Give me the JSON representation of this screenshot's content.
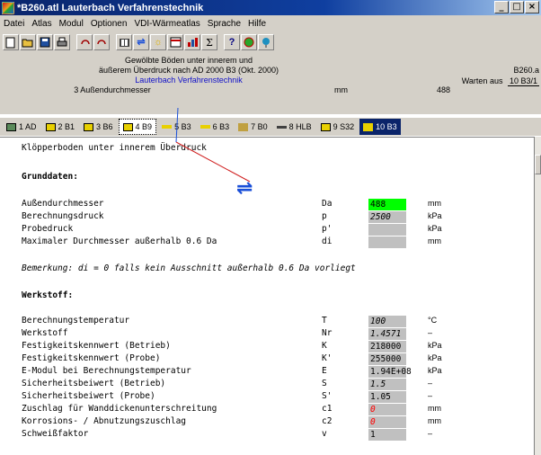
{
  "window": {
    "title": "*B260.atl   Lauterbach Verfahrenstechnik",
    "min": "_",
    "max": "□",
    "close": "×"
  },
  "menu": [
    "Datei",
    "Atlas",
    "Modul",
    "Optionen",
    "VDI-Wärmeatlas",
    "Sprache",
    "Hilfe"
  ],
  "toolbar_icons": [
    "new-icon",
    "open-icon",
    "save-icon",
    "print-icon",
    "undo-icon",
    "redo-icon",
    "book-icon",
    "swap-icon",
    "lightbulb-icon",
    "table-icon",
    "chart-icon",
    "sum-icon",
    "help-icon",
    "globe-icon",
    "info-icon"
  ],
  "header": {
    "line1": "Gewölbte Böden unter innerem und",
    "line2": "äußerem Überdruck nach AD 2000 B3 (Okt. 2000)",
    "line3": "Lauterbach Verfahrenstechnik",
    "line4_label": "3 Außendurchmesser",
    "line4_unit": "mm",
    "line4_value": "488",
    "right_top": "B260.a",
    "warten_label": "Warten aus",
    "warten_value": "10 B3/1"
  },
  "tabs": [
    {
      "label": "1 AD",
      "color": "#5a8a5a"
    },
    {
      "label": "2 B1",
      "color": "#e8d000"
    },
    {
      "label": "3 B6",
      "color": "#e8d000"
    },
    {
      "label": "4 B9",
      "color": "#e8d000"
    },
    {
      "label": "5 B3",
      "color": "#e8d000"
    },
    {
      "label": "6 B3",
      "color": "#e8d000"
    },
    {
      "label": "7 B0",
      "color": "#c0a040"
    },
    {
      "label": "8 HLB",
      "color": "#404040"
    },
    {
      "label": "9 S32",
      "color": "#e8d000"
    },
    {
      "label": "10 B3",
      "color": "#e8d000"
    }
  ],
  "content": {
    "title": "Klöpperboden unter innerem Überdruck",
    "section_grund": "Grunddaten:",
    "section_werk": "Werkstoff:",
    "remark": "Bemerkung: di = 0 falls kein Ausschnitt außerhalb 0.6 Da vorliegt",
    "grund_rows": [
      {
        "label": "Außendurchmesser",
        "sym": "Da",
        "val": "488",
        "unit": "mm"
      },
      {
        "label": "Berechnungsdruck",
        "sym": "p",
        "val": "2500",
        "unit": "kPa"
      },
      {
        "label": "Probedruck",
        "sym": "p'",
        "val": "",
        "unit": "kPa"
      },
      {
        "label": "Maximaler Durchmesser außerhalb 0.6 Da",
        "sym": "di",
        "val": "",
        "unit": "mm"
      }
    ],
    "werk_rows": [
      {
        "label": "Berechnungstemperatur",
        "sym": "T",
        "val": "100",
        "unit": "°C"
      },
      {
        "label": "Werkstoff",
        "sym": "Nr",
        "val": "1.4571",
        "unit": "–"
      },
      {
        "label": "Festigkeitskennwert (Betrieb)",
        "sym": "K",
        "val": "218000",
        "unit": "kPa"
      },
      {
        "label": "Festigkeitskennwert (Probe)",
        "sym": "K'",
        "val": "255000",
        "unit": "kPa"
      },
      {
        "label": "E-Modul bei Berechnungstemperatur",
        "sym": "E",
        "val": "1.94E+08",
        "unit": "kPa"
      },
      {
        "label": "Sicherheitsbeiwert  (Betrieb)",
        "sym": "S",
        "val": "1.5",
        "unit": "–"
      },
      {
        "label": "Sicherheitsbeiwert  (Probe)",
        "sym": "S'",
        "val": "1.05",
        "unit": "–"
      },
      {
        "label": "Zuschlag für Wanddickenunterschreitung",
        "sym": "c1",
        "val": "0",
        "unit": "mm"
      },
      {
        "label": "Korrosions- / Abnutzungszuschlag",
        "sym": "c2",
        "val": "0",
        "unit": "mm"
      },
      {
        "label": "Schweißfaktor",
        "sym": "v",
        "val": "1",
        "unit": "–"
      }
    ]
  },
  "colors": {
    "highlight": "#00ff00",
    "input_bg": "#c0c0c0",
    "red": "#ff0000",
    "swap": "#1a4fd8"
  }
}
